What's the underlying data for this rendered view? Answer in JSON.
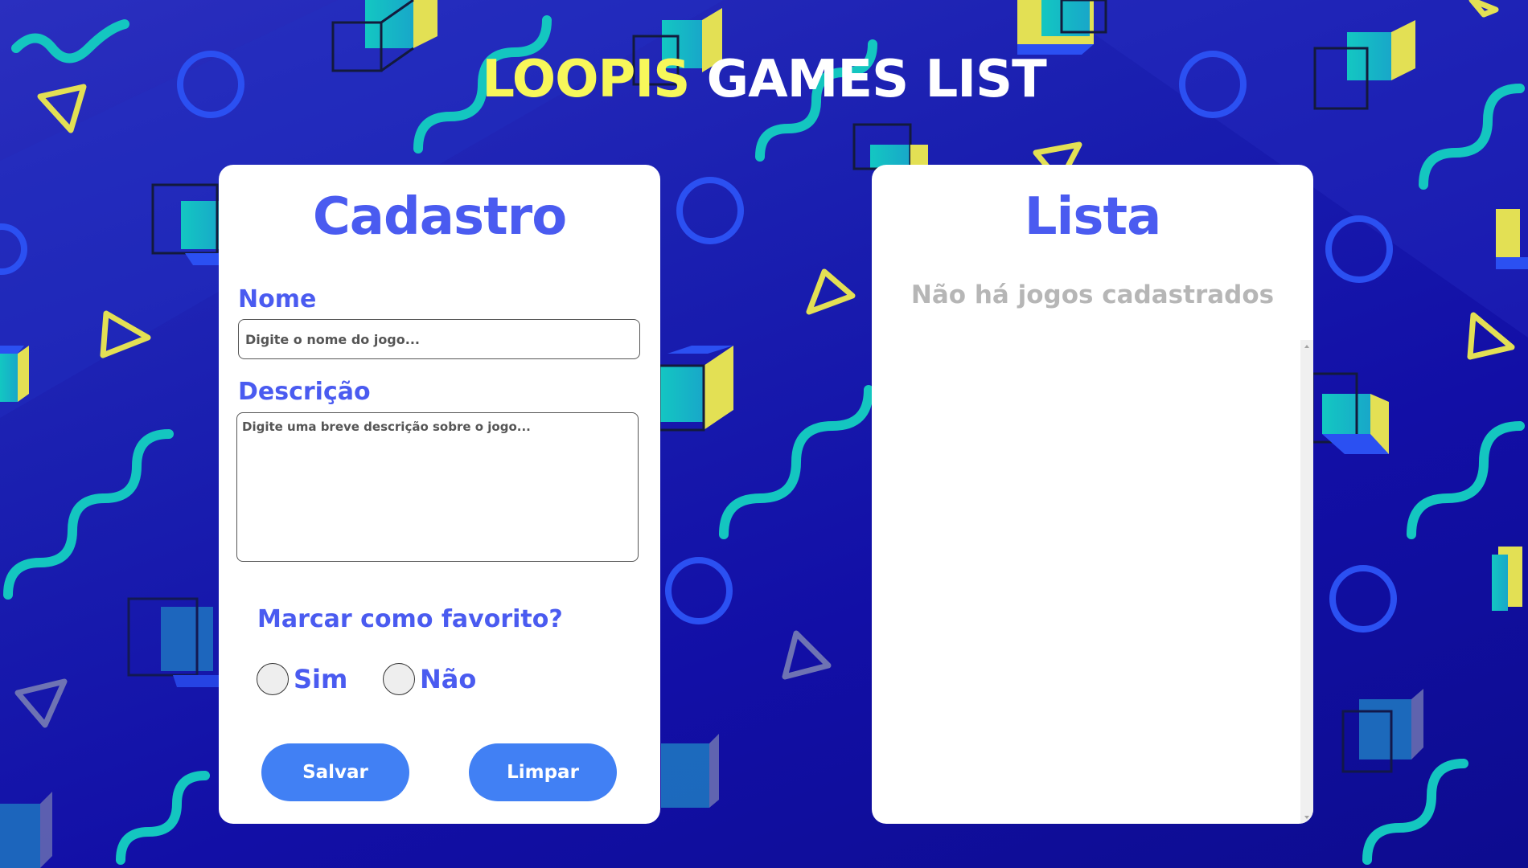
{
  "header": {
    "title_accent": "LOOPIS",
    "title_rest": "GAMES LIST"
  },
  "form": {
    "title": "Cadastro",
    "name_label": "Nome",
    "name_placeholder": "Digite o nome do jogo...",
    "name_value": "",
    "description_label": "Descrição",
    "description_placeholder": "Digite uma breve descrição sobre o jogo...",
    "description_value": "",
    "favorite_label": "Marcar como favorito?",
    "favorite_options": [
      "Sim",
      "Não"
    ],
    "save_label": "Salvar",
    "clear_label": "Limpar"
  },
  "list": {
    "title": "Lista",
    "empty_message": "Não há jogos cadastrados"
  },
  "colors": {
    "accent_blue": "#4a5bf0",
    "title_yellow": "#f7f75a",
    "button_blue": "#4180f4",
    "background_blue": "#1a1fb0"
  }
}
